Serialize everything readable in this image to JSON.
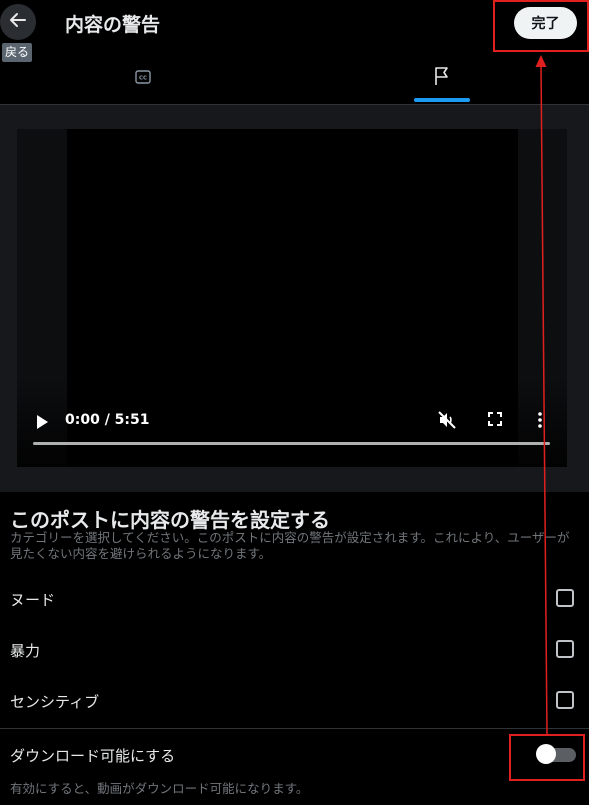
{
  "header": {
    "title": "内容の警告",
    "back_tooltip": "戻る",
    "done_label": "完了"
  },
  "tabs": [
    {
      "icon": "closed-captions-icon",
      "active": false
    },
    {
      "icon": "flag-icon",
      "active": true
    }
  ],
  "video": {
    "time": "0:00 / 5:51",
    "progress": 0
  },
  "warning_section": {
    "title": "このポストに内容の警告を設定する",
    "description": "カテゴリーを選択してください。このポストに内容の警告が設定されます。これにより、ユーザーが見たくない内容を避けられるようになります。"
  },
  "options": [
    {
      "label": "ヌード",
      "checked": false
    },
    {
      "label": "暴力",
      "checked": false
    },
    {
      "label": "センシティブ",
      "checked": false
    }
  ],
  "download": {
    "label": "ダウンロード可能にする",
    "description": "有効にすると、動画がダウンロード可能になります。",
    "enabled": false
  },
  "colors": {
    "accent": "#1d9bf0",
    "annotation": "#e0201e"
  }
}
